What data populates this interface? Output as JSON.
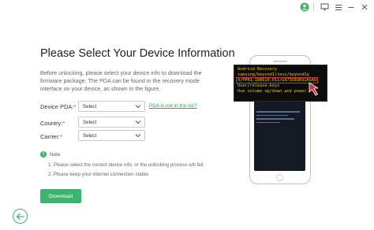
{
  "titlebar": {
    "icons": [
      "user-icon",
      "feedback-icon",
      "menu-icon",
      "minimize-icon",
      "close-icon"
    ],
    "accent": "#3cb46e"
  },
  "main": {
    "title": "Please Select Your Device Information",
    "description": "Before unlocking, please select your device info to download the firmware package. The PDA can be found in the recovery mode interface on your device, as shown in the figure.",
    "fields": [
      {
        "label": "Device PDA:",
        "required": "*",
        "value": "Select"
      },
      {
        "label": "Country:",
        "required": "*",
        "value": "Select"
      },
      {
        "label": "Carrier:",
        "required": "*",
        "value": "Select"
      }
    ],
    "pda_link": "PDA is not in the list?",
    "note": {
      "label": "Note",
      "lines": [
        "1. Please select the correct device info, or the unlocking process will fail.",
        "2. Please keep your internet connection stable."
      ]
    },
    "download_label": "Download"
  },
  "illustration": {
    "recovery_lines": [
      "Android Recovery",
      "samsung/beyond1ltexx/beyond1q",
      "9/PPR1.180610.011/G973UIUEU1ASA0",
      "User/release-keys",
      "Use volume up/down and power."
    ],
    "text_color": "#e8c21e",
    "highlight_color": "#d6332f"
  }
}
